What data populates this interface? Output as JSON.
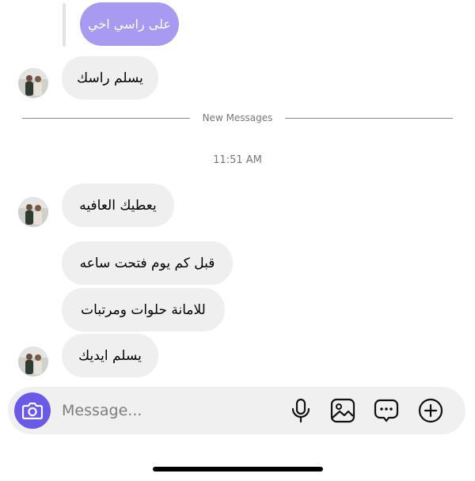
{
  "thread": {
    "reply_preview": "على راسي اخي",
    "messages_before_divider": [
      {
        "text": "يسلم راسك"
      }
    ],
    "divider_label": "New Messages",
    "timestamp": "11:51 AM",
    "messages_after_divider": [
      {
        "text": "يعطيك العافيه"
      },
      {
        "text": "قبل كم يوم فتحت ساعه"
      },
      {
        "text": "للامانة حلوات ومرتبات"
      },
      {
        "text": "يسلم ايديك"
      }
    ]
  },
  "composer": {
    "placeholder": "Message...",
    "icons": [
      "camera-icon",
      "microphone-icon",
      "gallery-icon",
      "sticker-icon",
      "add-icon"
    ]
  },
  "colors": {
    "accent": "#6a5ae8",
    "own_bubble": "#a89af0",
    "their_bubble": "#efefef"
  }
}
